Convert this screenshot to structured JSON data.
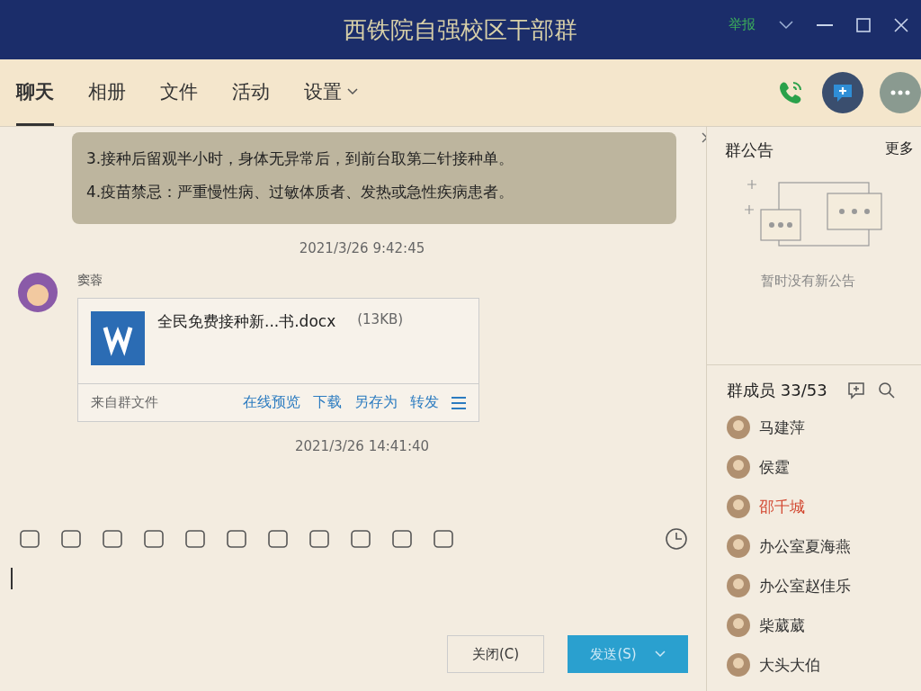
{
  "window": {
    "title": "西铁院自强校区干部群",
    "report": "举报"
  },
  "tabs": [
    {
      "label": "聊天",
      "selected": true,
      "dropdown": false
    },
    {
      "label": "相册",
      "selected": false,
      "dropdown": false
    },
    {
      "label": "文件",
      "selected": false,
      "dropdown": false
    },
    {
      "label": "活动",
      "selected": false,
      "dropdown": false
    },
    {
      "label": "设置",
      "selected": false,
      "dropdown": true
    }
  ],
  "messages": [
    {
      "kind": "notice",
      "lines": [
        "3.接种后留观半小时，身体无异常后，到前台取第二针接种单。",
        "4.疫苗禁忌：严重慢性病、过敏体质者、发热或急性疾病患者。"
      ]
    },
    {
      "kind": "time",
      "text": "2021/3/26 9:42:45"
    },
    {
      "kind": "file",
      "sender": "窦蓉",
      "file_name": "全民免费接种新...书.docx",
      "file_size": "(13KB)",
      "source": "来自群文件",
      "actions": [
        "在线预览",
        "下载",
        "另存为",
        "转发"
      ]
    },
    {
      "kind": "time",
      "text": "2021/3/26 14:41:40"
    }
  ],
  "announcement": {
    "title": "群公告",
    "more": "更多",
    "empty_text": "暂时没有新公告"
  },
  "members": {
    "title": "群成员 33/53",
    "items": [
      {
        "name": "马建萍",
        "color": "#333333"
      },
      {
        "name": "侯霆",
        "color": "#333333"
      },
      {
        "name": "邵千城",
        "color": "#d2462f"
      },
      {
        "name": "办公室夏海燕",
        "color": "#333333"
      },
      {
        "name": "办公室赵佳乐",
        "color": "#333333"
      },
      {
        "name": "柴葳葳",
        "color": "#333333"
      },
      {
        "name": "大头大伯",
        "color": "#333333"
      }
    ]
  },
  "buttons": {
    "close": "关闭(C)",
    "send": "发送(S)"
  }
}
